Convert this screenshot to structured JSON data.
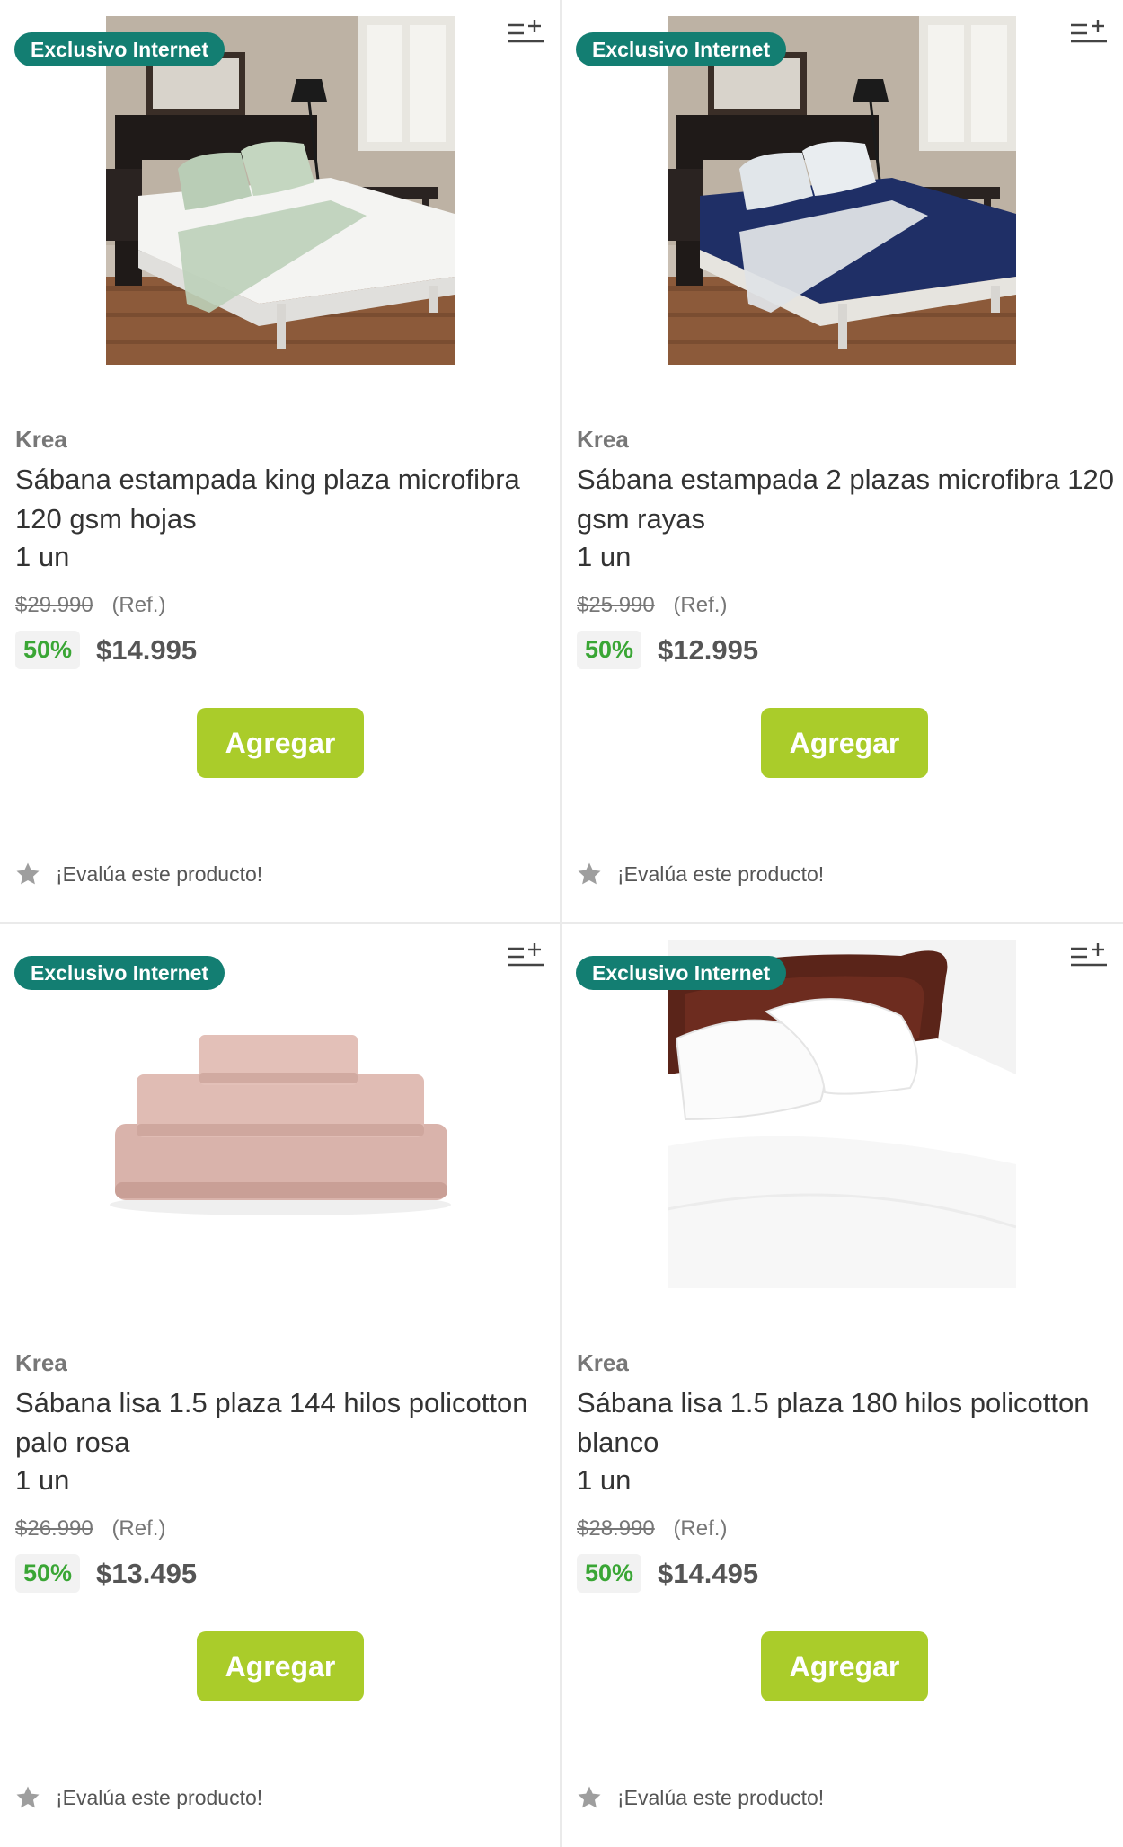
{
  "colors": {
    "badge": "#137e72",
    "button": "#aacc2a",
    "discount": "#3aa635"
  },
  "products": [
    {
      "badge": "Exclusivo Internet",
      "brand": "Krea",
      "title": "Sábana estampada king plaza microfibra 120 gsm hojas",
      "qty": "1 un",
      "old_price": "$29.990",
      "ref": "(Ref.)",
      "discount": "50%",
      "price": "$14.995",
      "button": "Agregar",
      "rate": "¡Evalúa este producto!",
      "image": "bed-white-sheets-leaf-pillows"
    },
    {
      "badge": "Exclusivo Internet",
      "brand": "Krea",
      "title": "Sábana estampada 2 plazas microfibra 120 gsm rayas",
      "qty": "1 un",
      "old_price": "$25.990",
      "ref": "(Ref.)",
      "discount": "50%",
      "price": "$12.995",
      "button": "Agregar",
      "rate": "¡Evalúa este producto!",
      "image": "bed-navy-sheets-striped-pillows"
    },
    {
      "badge": "Exclusivo Internet",
      "brand": "Krea",
      "title": "Sábana lisa 1.5 plaza 144 hilos policotton palo rosa",
      "qty": "1 un",
      "old_price": "$26.990",
      "ref": "(Ref.)",
      "discount": "50%",
      "price": "$13.495",
      "button": "Agregar",
      "rate": "¡Evalúa este producto!",
      "image": "folded-pink-sheets"
    },
    {
      "badge": "Exclusivo Internet",
      "brand": "Krea",
      "title": "Sábana lisa 1.5 plaza 180 hilos policotton blanco",
      "qty": "1 un",
      "old_price": "$28.990",
      "ref": "(Ref.)",
      "discount": "50%",
      "price": "$14.495",
      "button": "Agregar",
      "rate": "¡Evalúa este producto!",
      "image": "bed-white-sheets-wood-headboard"
    }
  ]
}
